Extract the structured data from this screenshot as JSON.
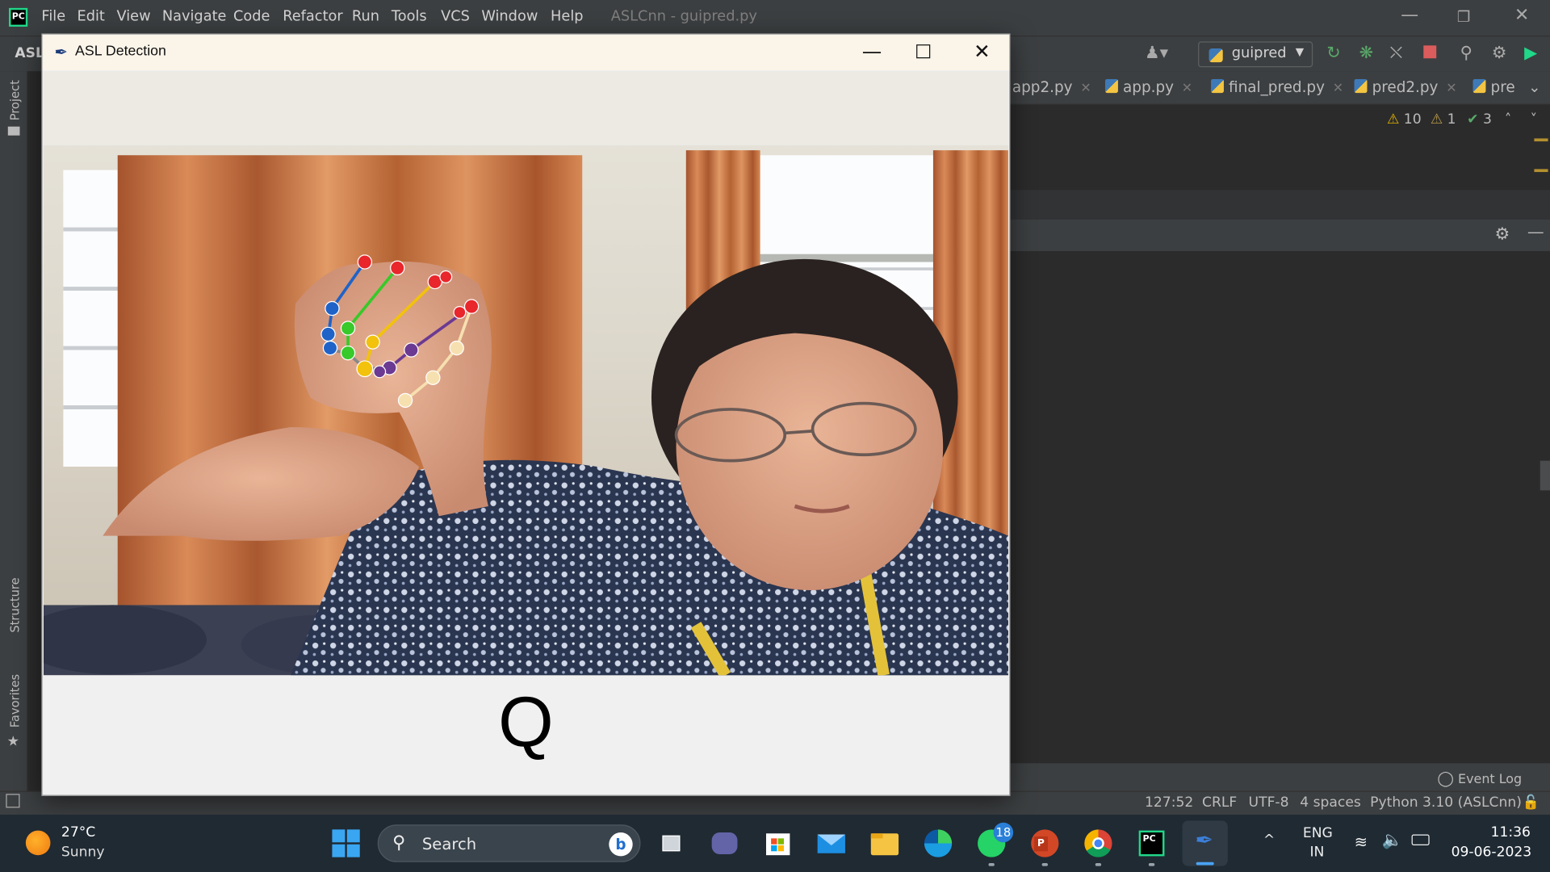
{
  "ide": {
    "menu": [
      "File",
      "Edit",
      "View",
      "Navigate",
      "Code",
      "Refactor",
      "Run",
      "Tools",
      "VCS",
      "Window",
      "Help"
    ],
    "window_title": "ASLCnn - guipred.py",
    "project_crumb": "ASL",
    "run_config": "guipred",
    "tabs": [
      "app2.py",
      "app.py",
      "final_pred.py",
      "pred2.py",
      "pre"
    ],
    "inspections": {
      "warnings": "10",
      "weak_warnings": "1",
      "ok": "3"
    },
    "side_labels": {
      "project": "Project",
      "structure": "Structure",
      "favorites": "Favorites"
    },
    "event_log": "Event Log",
    "status": {
      "position": "127:52",
      "line_sep": "CRLF",
      "encoding": "UTF-8",
      "indent": "4 spaces",
      "interpreter": "Python 3.10 (ASLCnn)"
    }
  },
  "asl_window": {
    "title": "ASL Detection",
    "prediction": "Q"
  },
  "taskbar": {
    "weather_temp": "27°C",
    "weather_cond": "Sunny",
    "search_label": "Search",
    "whatsapp_badge": "18",
    "lang_top": "ENG",
    "lang_bottom": "IN",
    "time": "11:36",
    "date": "09-06-2023"
  },
  "colors": {
    "ide_bg": "#2b2b2b",
    "ide_panel": "#3c3f41",
    "taskbar_bg": "#1f2a33",
    "landmark_thumb": "#e8262b",
    "landmark_index": "#38c92a",
    "landmark_middle": "#f2c20c",
    "landmark_ring": "#6b3a92",
    "landmark_pinky": "#f7e0b0",
    "landmark_wrist_side": "#1f63c8"
  }
}
